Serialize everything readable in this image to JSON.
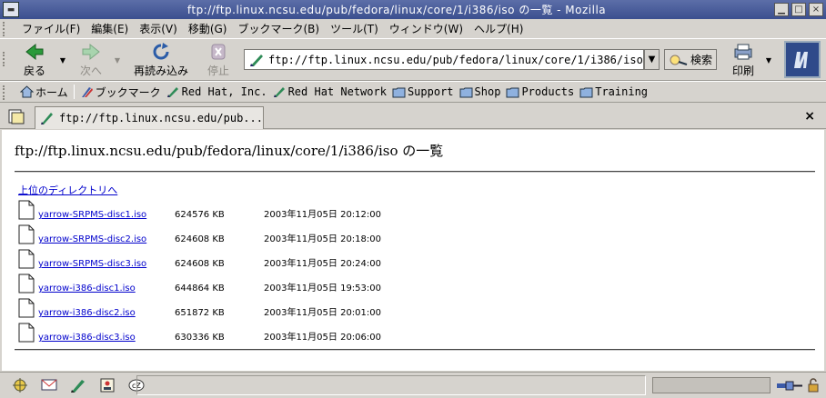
{
  "window": {
    "title": "ftp://ftp.linux.ncsu.edu/pub/fedora/linux/core/1/i386/iso の一覧 - Mozilla"
  },
  "menu": {
    "items": [
      "ファイル(F)",
      "編集(E)",
      "表示(V)",
      "移動(G)",
      "ブックマーク(B)",
      "ツール(T)",
      "ウィンドウ(W)",
      "ヘルプ(H)"
    ]
  },
  "toolbar": {
    "back_label": "戻る",
    "forward_label": "次へ",
    "reload_label": "再読み込み",
    "stop_label": "停止",
    "url": "ftp://ftp.linux.ncsu.edu/pub/fedora/linux/core/1/i386/iso",
    "search_label": "検索",
    "print_label": "印刷"
  },
  "bookmarks": {
    "home": "ホーム",
    "bookmarks": "ブックマーク",
    "items": [
      "Red Hat, Inc.",
      "Red Hat Network",
      "Support",
      "Shop",
      "Products",
      "Training"
    ]
  },
  "tab": {
    "label": "ftp://ftp.linux.ncsu.edu/pub...",
    "close": "×"
  },
  "content": {
    "heading": "ftp://ftp.linux.ncsu.edu/pub/fedora/linux/core/1/i386/iso の一覧",
    "parent_link": "上位のディレクトリへ",
    "files": [
      {
        "name": "yarrow-SRPMS-disc1.iso",
        "size": "624576 KB",
        "date": "2003年11月05日  20:12:00"
      },
      {
        "name": "yarrow-SRPMS-disc2.iso",
        "size": "624608 KB",
        "date": "2003年11月05日  20:18:00"
      },
      {
        "name": "yarrow-SRPMS-disc3.iso",
        "size": "624608 KB",
        "date": "2003年11月05日  20:24:00"
      },
      {
        "name": "yarrow-i386-disc1.iso",
        "size": "644864 KB",
        "date": "2003年11月05日  19:53:00"
      },
      {
        "name": "yarrow-i386-disc2.iso",
        "size": "651872 KB",
        "date": "2003年11月05日  20:01:00"
      },
      {
        "name": "yarrow-i386-disc3.iso",
        "size": "630336 KB",
        "date": "2003年11月05日  20:06:00"
      }
    ]
  },
  "colors": {
    "titlebar": "#3b4f8f",
    "link": "#0000cc",
    "chrome": "#d6d3ce"
  }
}
